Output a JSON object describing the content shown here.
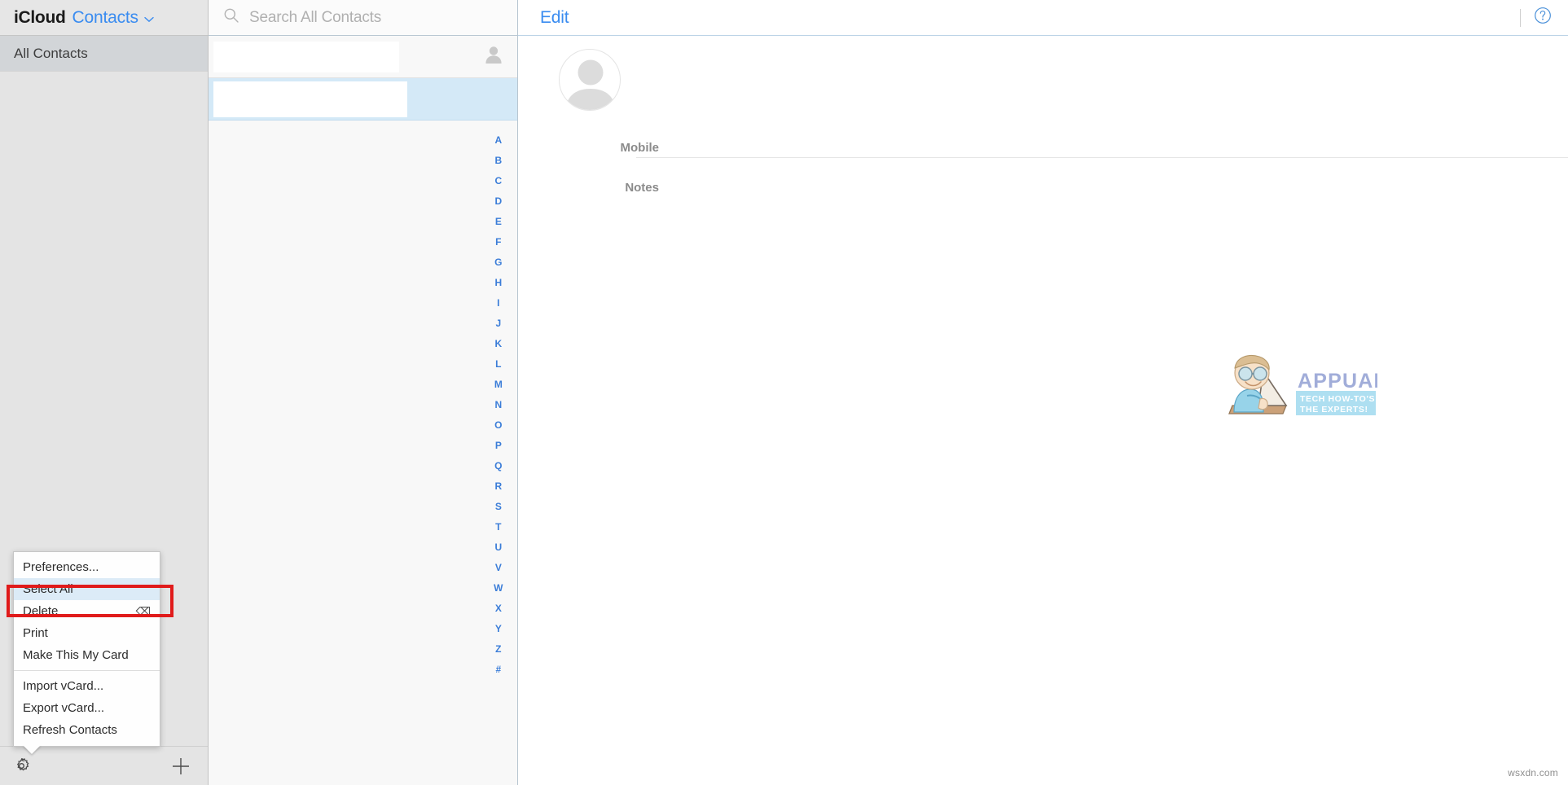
{
  "window": {
    "title": "iCloud Contacts"
  },
  "sidebar": {
    "brand_primary": "iCloud",
    "brand_app": "Contacts",
    "chevron": "⌄",
    "groups": [
      {
        "label": "All Contacts",
        "selected": true
      }
    ],
    "footer": {
      "settings_icon": "gear-icon",
      "add_icon": "plus-icon"
    }
  },
  "context_menu": {
    "visible": true,
    "highlighted_item": "Select All",
    "highlight_color": "#e01b1b",
    "items": [
      {
        "label": "Preferences...",
        "shortcut": "",
        "highlighted": false
      },
      {
        "label": "Select All",
        "shortcut": "",
        "highlighted": true
      },
      {
        "label": "Delete",
        "shortcut": "⌫",
        "highlighted": false
      },
      {
        "label": "Print",
        "shortcut": "",
        "highlighted": false
      },
      {
        "label": "Make This My Card",
        "shortcut": "",
        "highlighted": false
      },
      {
        "label": "Import vCard...",
        "shortcut": "",
        "highlighted": false,
        "separator_before": true
      },
      {
        "label": "Export vCard...",
        "shortcut": "",
        "highlighted": false
      },
      {
        "label": "Refresh Contacts",
        "shortcut": "",
        "highlighted": false
      }
    ]
  },
  "search": {
    "icon": "search-icon",
    "placeholder": "Search All Contacts",
    "value": ""
  },
  "contact_list": {
    "rows": [
      {
        "name": "",
        "redacted": true,
        "selected": false,
        "has_avatar": true
      },
      {
        "name": "",
        "redacted": true,
        "selected": true,
        "has_avatar": false
      }
    ],
    "alpha_index": [
      "A",
      "B",
      "C",
      "D",
      "E",
      "F",
      "G",
      "H",
      "I",
      "J",
      "K",
      "L",
      "M",
      "N",
      "O",
      "P",
      "Q",
      "R",
      "S",
      "T",
      "U",
      "V",
      "W",
      "X",
      "Y",
      "Z",
      "#"
    ]
  },
  "detail": {
    "edit_label": "Edit",
    "help_icon": "help-circle-icon",
    "avatar": "person-placeholder-icon",
    "fields": [
      {
        "label": "Mobile",
        "value": ""
      },
      {
        "label": "Notes",
        "value": ""
      }
    ]
  },
  "watermarks": {
    "brand_text": "APPUALS",
    "brand_tagline_line1": "TECH HOW-TO'S FROM",
    "brand_tagline_line2": "THE EXPERTS!",
    "corner_text": "wsxdn.com"
  },
  "colors": {
    "accent_blue": "#3a8cf0",
    "index_blue": "#3b7dd8",
    "selection_blue": "#d4e9f7",
    "menu_highlight": "#dcebf7",
    "highlight_red": "#e01b1b",
    "sidebar_bg": "#e4e4e4"
  }
}
